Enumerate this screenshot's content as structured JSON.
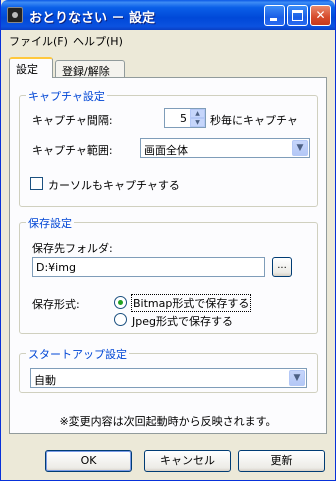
{
  "window": {
    "title": "おとりなさい － 設定"
  },
  "menu": {
    "file": "ファイル(F)",
    "help": "ヘルプ(H)"
  },
  "tabs": {
    "settings": "設定",
    "register": "登録/解除"
  },
  "capture": {
    "group_title": "キャプチャ設定",
    "interval_label": "キャプチャ間隔:",
    "interval_value": "5",
    "interval_suffix": "秒毎にキャプチャ",
    "range_label": "キャプチャ範囲:",
    "range_value": "画面全体",
    "cursor_label": "カーソルもキャプチャする",
    "cursor_checked": false
  },
  "save": {
    "group_title": "保存設定",
    "folder_label": "保存先フォルダ:",
    "folder_value": "D:¥img",
    "browse_label": "...",
    "format_label": "保存形式:",
    "format_bitmap": "Bitmap形式で保存する",
    "format_jpeg": "Jpeg形式で保存する",
    "format_selected": "bitmap"
  },
  "startup": {
    "group_title": "スタートアップ設定",
    "value": "自動"
  },
  "note": "※変更内容は次回起動時から反映されます。",
  "buttons": {
    "ok": "OK",
    "cancel": "キャンセル",
    "update": "更新"
  },
  "colors": {
    "titlebar": "#0a5fe8",
    "group_title": "#0046d5",
    "face": "#ece9d8"
  },
  "icons": {
    "minimize": "minimize-icon",
    "maximize": "maximize-icon",
    "close": "close-icon"
  }
}
